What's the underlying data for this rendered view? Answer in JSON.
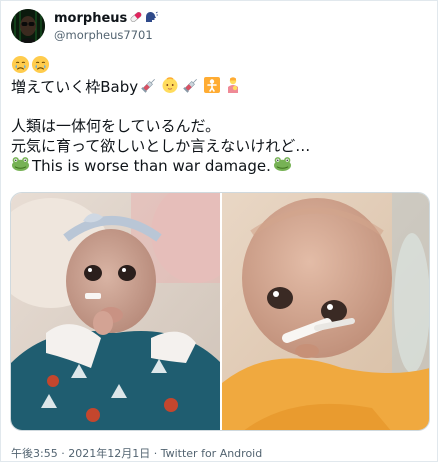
{
  "author": {
    "display_name": "morpheus",
    "name_emojis": [
      "pill-emoji",
      "speaking-head-emoji"
    ],
    "handle": "@morpheus7701",
    "avatar": "matrix-morpheus-avatar"
  },
  "tweet": {
    "line1_emojis": [
      "crying-face-emoji",
      "crying-face-emoji"
    ],
    "line2_text": "増えていく枠Baby",
    "line2_emojis": [
      "syringe-emoji",
      "baby-emoji",
      "syringe-emoji",
      "baby-symbol-emoji",
      "breastfeeding-emoji"
    ],
    "line3_text": "人類は一体何をしているんだ。",
    "line4_text": "元気に育って欲しいとしか言えないけれど…",
    "line5_text": "This is worse than war damage.",
    "line5_emojis": [
      "frog-emoji",
      "frog-emoji"
    ]
  },
  "media": {
    "photos": [
      "infant-photo-left",
      "infant-photo-right"
    ]
  },
  "footer": {
    "time": "午後3:55",
    "separator1": " · ",
    "date": "2021年12月1日",
    "separator2": " · ",
    "source": "Twitter for Android"
  },
  "colors": {
    "text_primary": "#0f1419",
    "text_secondary": "#536471",
    "border": "#cfd9de"
  }
}
